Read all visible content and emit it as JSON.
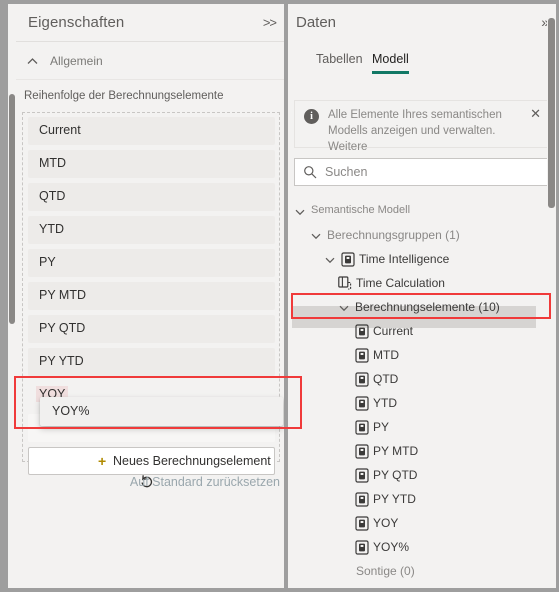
{
  "left_panel": {
    "title": "Eigenschaften",
    "collapse_icon_label": ">>",
    "section": {
      "label": "Allgemein",
      "chevron": "chevron-up"
    },
    "order_label": "Reihenfolge der Berechnungselemente",
    "order_items": [
      "Current",
      "MTD",
      "QTD",
      "YTD",
      "PY",
      "PY MTD",
      "PY QTD",
      "PY YTD",
      "YOY"
    ],
    "dragging_item": "YOY%",
    "new_item": {
      "plus": "+",
      "label": "Neues Berechnungselement"
    },
    "reset": {
      "icon": "undo-icon",
      "label": "Auf Standard zurücksetzen"
    }
  },
  "right_panel": {
    "title": "Daten",
    "collapse_icon_label": "»",
    "tabs": [
      {
        "label": "Tabellen",
        "active": false
      },
      {
        "label": "Modell",
        "active": true
      }
    ],
    "accent_color": "#117865",
    "info_banner": {
      "icon": "info-icon",
      "text": "Alle Elemente Ihres semantischen Modells anzeigen und verwalten. Weitere",
      "close_label": "✕"
    },
    "search": {
      "placeholder": "Suchen",
      "icon": "search-icon"
    },
    "tree": [
      {
        "label": "Semantische Modell",
        "indent": 0,
        "chevron": "down",
        "icon": null,
        "muted": true,
        "small": true
      },
      {
        "label": "Berechnungsgruppen (1)",
        "indent": 1,
        "chevron": "down",
        "icon": null,
        "muted": true,
        "small": false
      },
      {
        "label": "Time Intelligence",
        "indent": 2,
        "chevron": "down",
        "icon": "calc-group-icon",
        "muted": false,
        "small": false
      },
      {
        "label": "Time Calculation",
        "indent": 3,
        "chevron": null,
        "icon": "column-icon",
        "muted": false,
        "small": false
      },
      {
        "label": "Berechnungselemente (10)",
        "indent": 3,
        "chevron": "down",
        "icon": null,
        "muted": false,
        "small": false
      },
      {
        "label": "Current",
        "indent": 4,
        "chevron": null,
        "icon": "calc-item-icon",
        "muted": false,
        "small": false
      },
      {
        "label": "MTD",
        "indent": 4,
        "chevron": null,
        "icon": "calc-item-icon",
        "muted": false,
        "small": false
      },
      {
        "label": "QTD",
        "indent": 4,
        "chevron": null,
        "icon": "calc-item-icon",
        "muted": false,
        "small": false
      },
      {
        "label": "YTD",
        "indent": 4,
        "chevron": null,
        "icon": "calc-item-icon",
        "muted": false,
        "small": false
      },
      {
        "label": "PY",
        "indent": 4,
        "chevron": null,
        "icon": "calc-item-icon",
        "muted": false,
        "small": false
      },
      {
        "label": "PY MTD",
        "indent": 4,
        "chevron": null,
        "icon": "calc-item-icon",
        "muted": false,
        "small": false
      },
      {
        "label": "PY QTD",
        "indent": 4,
        "chevron": null,
        "icon": "calc-item-icon",
        "muted": false,
        "small": false
      },
      {
        "label": "PY YTD",
        "indent": 4,
        "chevron": null,
        "icon": "calc-item-icon",
        "muted": false,
        "small": false
      },
      {
        "label": "YOY",
        "indent": 4,
        "chevron": null,
        "icon": "calc-item-icon",
        "muted": false,
        "small": false
      },
      {
        "label": "YOY%",
        "indent": 4,
        "chevron": null,
        "icon": "calc-item-icon",
        "muted": false,
        "small": false
      },
      {
        "label": "Sontige (0)",
        "indent": 3,
        "chevron": null,
        "icon": null,
        "muted": true,
        "small": false
      }
    ]
  },
  "annotations": {
    "highlight_color": "#f03a3a",
    "boxes": [
      {
        "name": "berechnungselemente-callout"
      },
      {
        "name": "drag-drop-callout"
      }
    ]
  }
}
